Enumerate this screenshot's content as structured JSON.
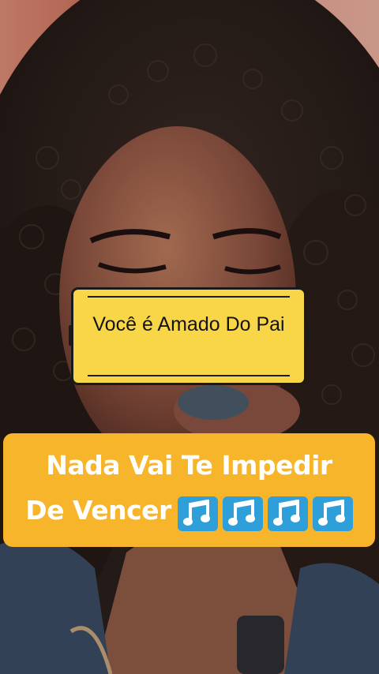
{
  "caption": {
    "text": "Você é Amado Do Pai"
  },
  "banner": {
    "line1": "Nada Vai Te Impedir",
    "line2": "De Vencer",
    "note_icons": [
      "music-note-icon",
      "music-note-icon",
      "music-note-icon",
      "music-note-icon"
    ]
  },
  "colors": {
    "caption_bg": "#f9d548",
    "banner_bg": "#f6b52b",
    "note_bg": "#2f9fd9"
  }
}
